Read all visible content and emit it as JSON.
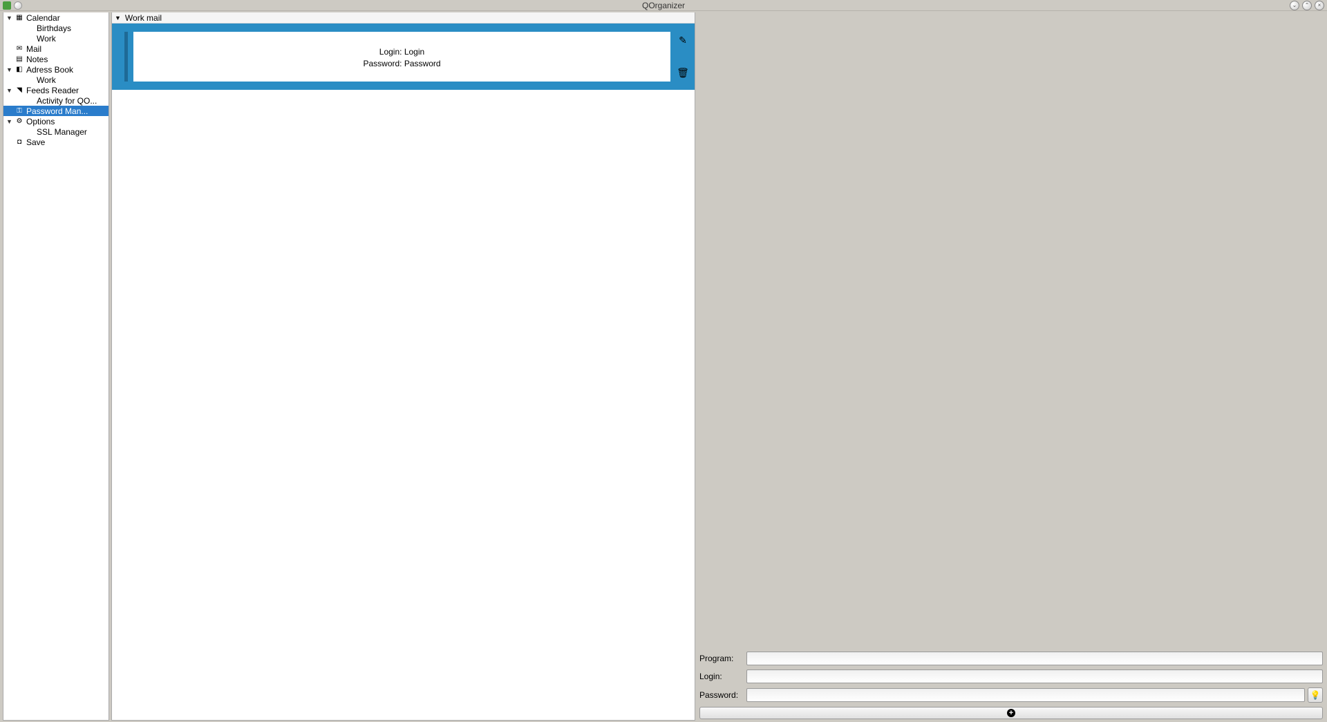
{
  "window": {
    "title": "QOrganizer"
  },
  "sidebar": {
    "items": [
      {
        "label": "Calendar",
        "icon": "calendar",
        "expandable": true
      },
      {
        "label": "Birthdays",
        "child": true
      },
      {
        "label": "Work",
        "child": true
      },
      {
        "label": "Mail",
        "icon": "mail"
      },
      {
        "label": "Notes",
        "icon": "notes"
      },
      {
        "label": "Adress Book",
        "icon": "addressbook",
        "expandable": true
      },
      {
        "label": "Work",
        "child": true
      },
      {
        "label": "Feeds Reader",
        "icon": "feeds",
        "expandable": true
      },
      {
        "label": "Activity for QO...",
        "child": true
      },
      {
        "label": "Password Man...",
        "icon": "key",
        "selected": true
      },
      {
        "label": "Options",
        "icon": "gear",
        "expandable": true
      },
      {
        "label": "SSL Manager",
        "child": true
      },
      {
        "label": "Save",
        "icon": "save"
      }
    ]
  },
  "content": {
    "header": "Work mail",
    "entry": {
      "login_label": "Login:",
      "login_value": "Login",
      "password_label": "Password:",
      "password_value": "Password"
    }
  },
  "form": {
    "program_label": "Program:",
    "login_label": "Login:",
    "password_label": "Password:",
    "program_value": "",
    "login_value": "",
    "password_value": ""
  }
}
